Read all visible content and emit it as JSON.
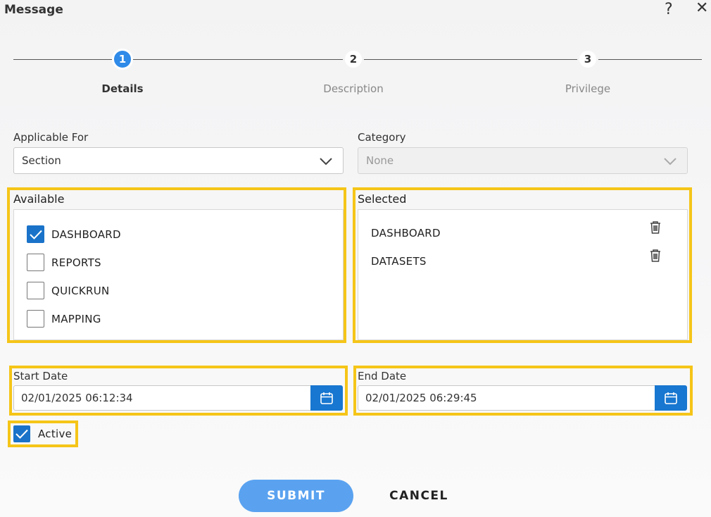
{
  "dialog": {
    "title": "Message"
  },
  "icons": {
    "help": "?",
    "close": "✕"
  },
  "steps": [
    {
      "number": "1",
      "label": "Details",
      "state": "active"
    },
    {
      "number": "2",
      "label": "Description",
      "state": "inactive"
    },
    {
      "number": "3",
      "label": "Privilege",
      "state": "inactive"
    }
  ],
  "applicable_for": {
    "label": "Applicable For",
    "value": "Section"
  },
  "category": {
    "label": "Category",
    "value": "None",
    "disabled": true
  },
  "available": {
    "title": "Available",
    "items": [
      {
        "label": "DASHBOARD",
        "checked": true
      },
      {
        "label": "REPORTS",
        "checked": false
      },
      {
        "label": "QUICKRUN",
        "checked": false
      },
      {
        "label": "MAPPING",
        "checked": false
      }
    ]
  },
  "selected": {
    "title": "Selected",
    "items": [
      {
        "label": "DASHBOARD"
      },
      {
        "label": "DATASETS"
      }
    ]
  },
  "start_date": {
    "label": "Start Date",
    "value": "02/01/2025 06:12:34"
  },
  "end_date": {
    "label": "End Date",
    "value": "02/01/2025 06:29:45"
  },
  "active": {
    "label": "Active",
    "checked": true
  },
  "buttons": {
    "submit": "SUBMIT",
    "cancel": "CANCEL"
  },
  "colors": {
    "accent": "#2f8ae8",
    "highlight": "#f5c518",
    "submit_bg": "#5aa2f0",
    "calendar_bg": "#1877d0"
  }
}
